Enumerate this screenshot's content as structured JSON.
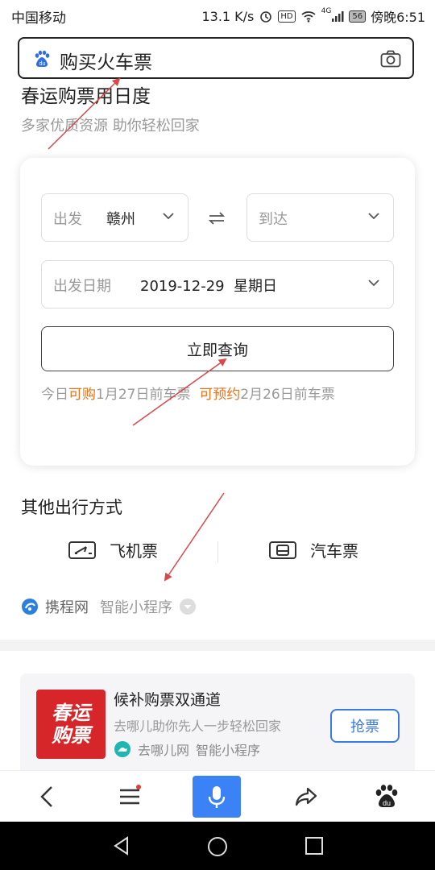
{
  "status_bar": {
    "carrier": "中国移动",
    "speed": "13.1 K/s",
    "hd": "HD",
    "network": "4G",
    "battery": "56",
    "time": "傍晚6:51"
  },
  "search": {
    "query": "购买火车票"
  },
  "hero": {
    "title": "春运购票用日度",
    "subtitle": "多家优质资源 助你轻松回家"
  },
  "ticket_form": {
    "from_label": "出发",
    "from_value": "赣州",
    "to_label": "到达",
    "date_label": "出发日期",
    "date_value": "2019-12-29  星期日",
    "query_button": "立即查询",
    "note_prefix": "今日",
    "note_buy": "可购",
    "note_mid": "1月27日前车票",
    "note_reserve": "可预约",
    "note_end": "2月26日前车票"
  },
  "other_modes": {
    "title": "其他出行方式",
    "flight": "飞机票",
    "bus": "汽车票",
    "provider": "携程网",
    "provider_type": "智能小程序"
  },
  "ad": {
    "image_line1": "春运",
    "image_line2": "购票",
    "title": "候补购票双通道",
    "subtitle": "去哪儿助你先人一步轻松回家",
    "source": "去哪儿网",
    "source_type": "智能小程序",
    "button": "抢票"
  },
  "colors": {
    "accent_orange": "#e8731c",
    "accent_blue": "#3b7ae0",
    "mic_blue": "#3b82f6",
    "annotation_red": "#d9484a"
  },
  "icons": [
    "baidu-paw-icon",
    "camera-icon",
    "chevron-down-icon",
    "swap-icon",
    "airplane-ticket-icon",
    "bus-ticket-icon",
    "ctrip-logo-icon",
    "back-icon",
    "menu-icon",
    "mic-icon",
    "share-icon",
    "baidu-home-icon"
  ]
}
